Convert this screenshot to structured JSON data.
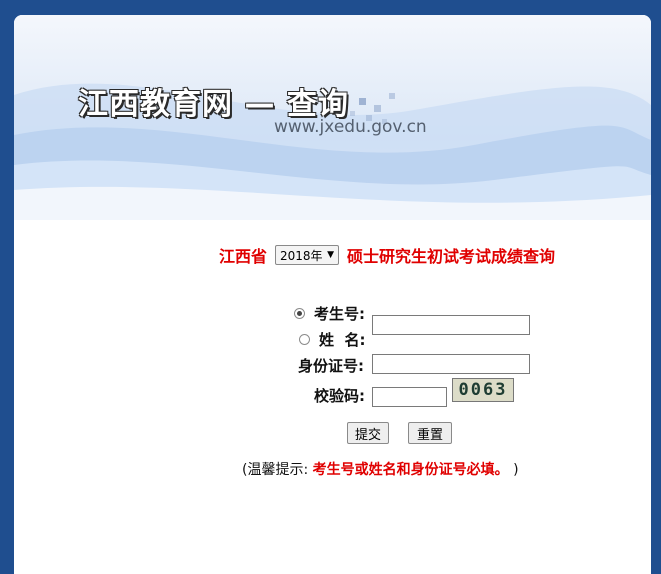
{
  "banner": {
    "site_title": "江西教育网 — 查询",
    "site_url": "www.jxedu.gov.cn"
  },
  "query": {
    "province": "江西省",
    "year_selected": "2018年",
    "exam_title": "硕士研究生初试考试成绩查询"
  },
  "form": {
    "radio_exam_number_label": "考生号:",
    "radio_name_label": "姓  名:",
    "radio_selected": "exam_number",
    "id_number_label": "身份证号:",
    "captcha_label": "校验码:",
    "captcha_text": "0063",
    "submit_label": "提交",
    "reset_label": "重置"
  },
  "tip": {
    "prefix": "(温馨提示:",
    "warning": "考生号或姓名和身份证号必填。",
    "suffix": ")"
  },
  "colors": {
    "background": "#1f4e8f",
    "accent_red": "#e00000"
  },
  "icons": {
    "radio_checked": "radio-checked-icon",
    "radio_unchecked": "radio-unchecked-icon",
    "dropdown": "chevron-down-icon"
  }
}
